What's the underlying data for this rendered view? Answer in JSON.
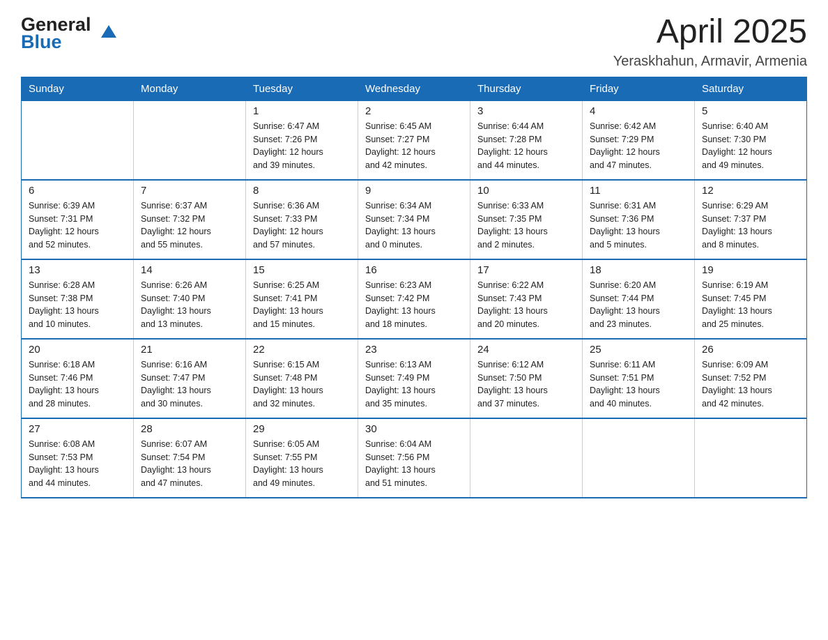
{
  "header": {
    "logo_general": "General",
    "logo_blue": "Blue",
    "month_year": "April 2025",
    "location": "Yeraskhahun, Armavir, Armenia"
  },
  "weekdays": [
    "Sunday",
    "Monday",
    "Tuesday",
    "Wednesday",
    "Thursday",
    "Friday",
    "Saturday"
  ],
  "weeks": [
    [
      {
        "day": "",
        "info": ""
      },
      {
        "day": "",
        "info": ""
      },
      {
        "day": "1",
        "info": "Sunrise: 6:47 AM\nSunset: 7:26 PM\nDaylight: 12 hours\nand 39 minutes."
      },
      {
        "day": "2",
        "info": "Sunrise: 6:45 AM\nSunset: 7:27 PM\nDaylight: 12 hours\nand 42 minutes."
      },
      {
        "day": "3",
        "info": "Sunrise: 6:44 AM\nSunset: 7:28 PM\nDaylight: 12 hours\nand 44 minutes."
      },
      {
        "day": "4",
        "info": "Sunrise: 6:42 AM\nSunset: 7:29 PM\nDaylight: 12 hours\nand 47 minutes."
      },
      {
        "day": "5",
        "info": "Sunrise: 6:40 AM\nSunset: 7:30 PM\nDaylight: 12 hours\nand 49 minutes."
      }
    ],
    [
      {
        "day": "6",
        "info": "Sunrise: 6:39 AM\nSunset: 7:31 PM\nDaylight: 12 hours\nand 52 minutes."
      },
      {
        "day": "7",
        "info": "Sunrise: 6:37 AM\nSunset: 7:32 PM\nDaylight: 12 hours\nand 55 minutes."
      },
      {
        "day": "8",
        "info": "Sunrise: 6:36 AM\nSunset: 7:33 PM\nDaylight: 12 hours\nand 57 minutes."
      },
      {
        "day": "9",
        "info": "Sunrise: 6:34 AM\nSunset: 7:34 PM\nDaylight: 13 hours\nand 0 minutes."
      },
      {
        "day": "10",
        "info": "Sunrise: 6:33 AM\nSunset: 7:35 PM\nDaylight: 13 hours\nand 2 minutes."
      },
      {
        "day": "11",
        "info": "Sunrise: 6:31 AM\nSunset: 7:36 PM\nDaylight: 13 hours\nand 5 minutes."
      },
      {
        "day": "12",
        "info": "Sunrise: 6:29 AM\nSunset: 7:37 PM\nDaylight: 13 hours\nand 8 minutes."
      }
    ],
    [
      {
        "day": "13",
        "info": "Sunrise: 6:28 AM\nSunset: 7:38 PM\nDaylight: 13 hours\nand 10 minutes."
      },
      {
        "day": "14",
        "info": "Sunrise: 6:26 AM\nSunset: 7:40 PM\nDaylight: 13 hours\nand 13 minutes."
      },
      {
        "day": "15",
        "info": "Sunrise: 6:25 AM\nSunset: 7:41 PM\nDaylight: 13 hours\nand 15 minutes."
      },
      {
        "day": "16",
        "info": "Sunrise: 6:23 AM\nSunset: 7:42 PM\nDaylight: 13 hours\nand 18 minutes."
      },
      {
        "day": "17",
        "info": "Sunrise: 6:22 AM\nSunset: 7:43 PM\nDaylight: 13 hours\nand 20 minutes."
      },
      {
        "day": "18",
        "info": "Sunrise: 6:20 AM\nSunset: 7:44 PM\nDaylight: 13 hours\nand 23 minutes."
      },
      {
        "day": "19",
        "info": "Sunrise: 6:19 AM\nSunset: 7:45 PM\nDaylight: 13 hours\nand 25 minutes."
      }
    ],
    [
      {
        "day": "20",
        "info": "Sunrise: 6:18 AM\nSunset: 7:46 PM\nDaylight: 13 hours\nand 28 minutes."
      },
      {
        "day": "21",
        "info": "Sunrise: 6:16 AM\nSunset: 7:47 PM\nDaylight: 13 hours\nand 30 minutes."
      },
      {
        "day": "22",
        "info": "Sunrise: 6:15 AM\nSunset: 7:48 PM\nDaylight: 13 hours\nand 32 minutes."
      },
      {
        "day": "23",
        "info": "Sunrise: 6:13 AM\nSunset: 7:49 PM\nDaylight: 13 hours\nand 35 minutes."
      },
      {
        "day": "24",
        "info": "Sunrise: 6:12 AM\nSunset: 7:50 PM\nDaylight: 13 hours\nand 37 minutes."
      },
      {
        "day": "25",
        "info": "Sunrise: 6:11 AM\nSunset: 7:51 PM\nDaylight: 13 hours\nand 40 minutes."
      },
      {
        "day": "26",
        "info": "Sunrise: 6:09 AM\nSunset: 7:52 PM\nDaylight: 13 hours\nand 42 minutes."
      }
    ],
    [
      {
        "day": "27",
        "info": "Sunrise: 6:08 AM\nSunset: 7:53 PM\nDaylight: 13 hours\nand 44 minutes."
      },
      {
        "day": "28",
        "info": "Sunrise: 6:07 AM\nSunset: 7:54 PM\nDaylight: 13 hours\nand 47 minutes."
      },
      {
        "day": "29",
        "info": "Sunrise: 6:05 AM\nSunset: 7:55 PM\nDaylight: 13 hours\nand 49 minutes."
      },
      {
        "day": "30",
        "info": "Sunrise: 6:04 AM\nSunset: 7:56 PM\nDaylight: 13 hours\nand 51 minutes."
      },
      {
        "day": "",
        "info": ""
      },
      {
        "day": "",
        "info": ""
      },
      {
        "day": "",
        "info": ""
      }
    ]
  ]
}
